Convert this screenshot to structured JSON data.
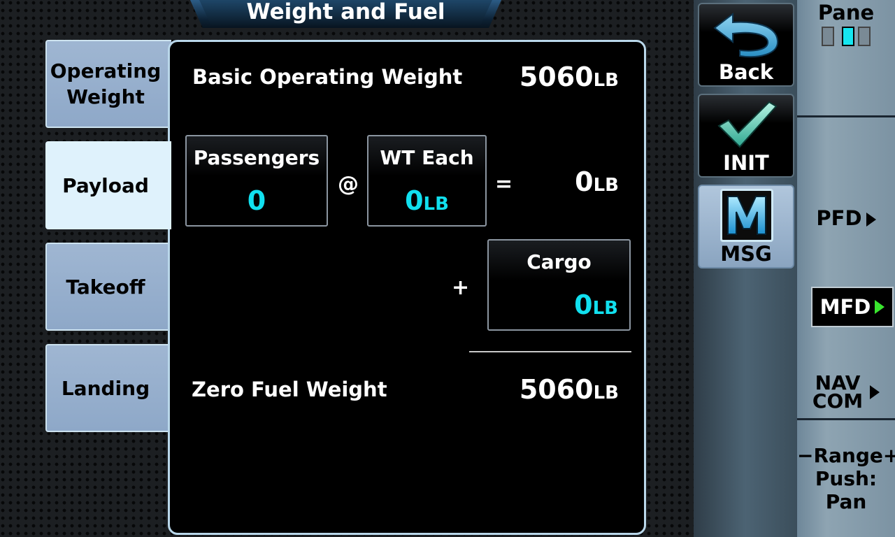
{
  "header": {
    "title": "Weight and Fuel"
  },
  "tabs": [
    {
      "label_line1": "Operating",
      "label_line2": "Weight",
      "active": false
    },
    {
      "label": "Payload",
      "active": true
    },
    {
      "label": "Takeoff",
      "active": false
    },
    {
      "label": "Landing",
      "active": false
    }
  ],
  "basic_operating": {
    "label": "Basic Operating Weight",
    "value": "5060",
    "unit": "LB"
  },
  "passengers": {
    "label": "Passengers",
    "value": "0"
  },
  "at_symbol": "@",
  "wt_each": {
    "label": "WT Each",
    "value": "0",
    "unit": "LB"
  },
  "equals_symbol": "=",
  "payload_total": {
    "value": "0",
    "unit": "LB"
  },
  "plus_symbol": "+",
  "cargo": {
    "label": "Cargo",
    "value": "0",
    "unit": "LB"
  },
  "zero_fuel": {
    "label": "Zero Fuel Weight",
    "value": "5060",
    "unit": "LB"
  },
  "buttons": {
    "back": "Back",
    "init": "INIT",
    "msg": "MSG"
  },
  "soft_keys": {
    "pane": "Pane",
    "pfd": "PFD",
    "mfd": "MFD",
    "nav_line1": "NAV",
    "nav_line2": "COM",
    "range_line1": "−Range+",
    "range_line2": "Push:",
    "range_line3": "Pan"
  },
  "colors": {
    "accent": "#11e0ef",
    "active_arrow": "#39e52e",
    "tab": "#9fb6d2",
    "active_tab": "#dff2fc"
  }
}
